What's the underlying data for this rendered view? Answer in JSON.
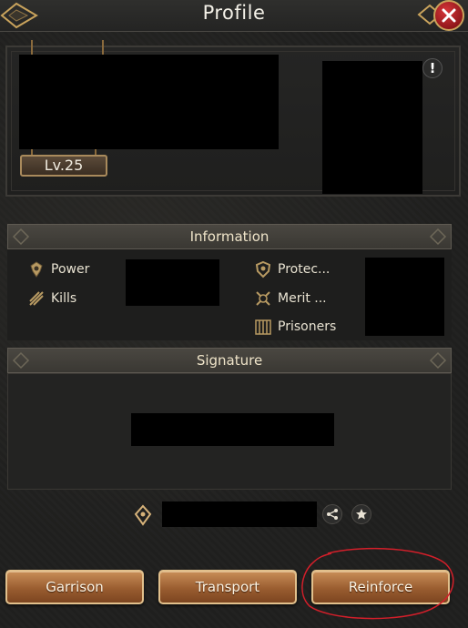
{
  "header": {
    "title": "Profile"
  },
  "profile": {
    "level": "Lv.25",
    "alert_glyph": "!"
  },
  "information": {
    "title": "Information",
    "left_items": [
      {
        "label": "Power",
        "icon": "power-icon"
      },
      {
        "label": "Kills",
        "icon": "kills-icon"
      }
    ],
    "right_items": [
      {
        "label": "Protec...",
        "icon": "protection-shield-icon"
      },
      {
        "label": "Merit ...",
        "icon": "merit-icon"
      },
      {
        "label": "Prisoners",
        "icon": "prisoners-icon"
      }
    ]
  },
  "signature": {
    "title": "Signature"
  },
  "actions": {
    "garrison": "Garrison",
    "transport": "Transport",
    "reinforce": "Reinforce"
  },
  "colors": {
    "accent_gold": "#c9a35c",
    "button_bronze": "#9a5d30",
    "close_red": "#c8282d",
    "annotation_red": "#d41f2a"
  }
}
